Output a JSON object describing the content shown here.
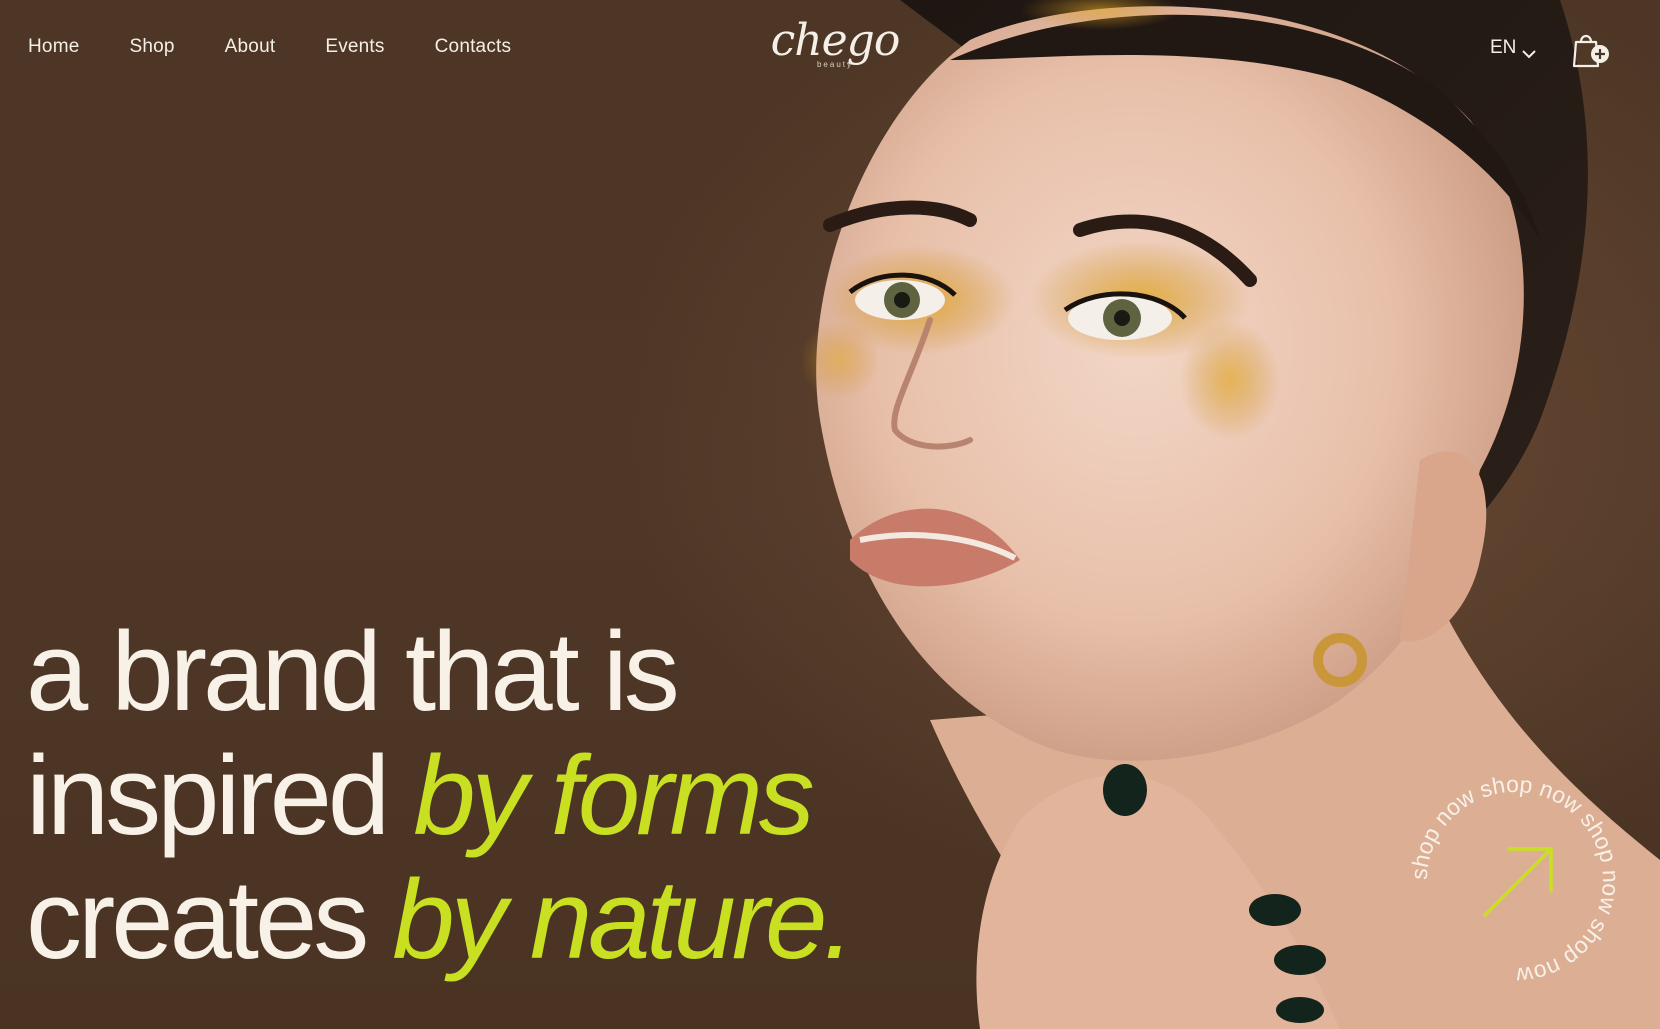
{
  "nav": {
    "items": [
      {
        "label": "Home"
      },
      {
        "label": "Shop"
      },
      {
        "label": "About"
      },
      {
        "label": "Events"
      },
      {
        "label": "Contacts"
      }
    ]
  },
  "brand": {
    "logo_text": "chego",
    "logo_sub": "beauty"
  },
  "header": {
    "language": "EN",
    "language_icon": "chevron-down-icon",
    "cart_icon": "shopping-bag-plus-icon"
  },
  "hero": {
    "line1": "a brand that is",
    "line2_plain": "inspired ",
    "line2_accent": "by forms",
    "line3_plain": "creates ",
    "line3_accent": "by nature.",
    "accent_color": "#c8e021",
    "text_color": "#f7f1e8",
    "background_color": "#4d3625"
  },
  "cta": {
    "ring_text": "shop now shop now shop now shop now",
    "icon": "arrow-up-right-icon"
  }
}
